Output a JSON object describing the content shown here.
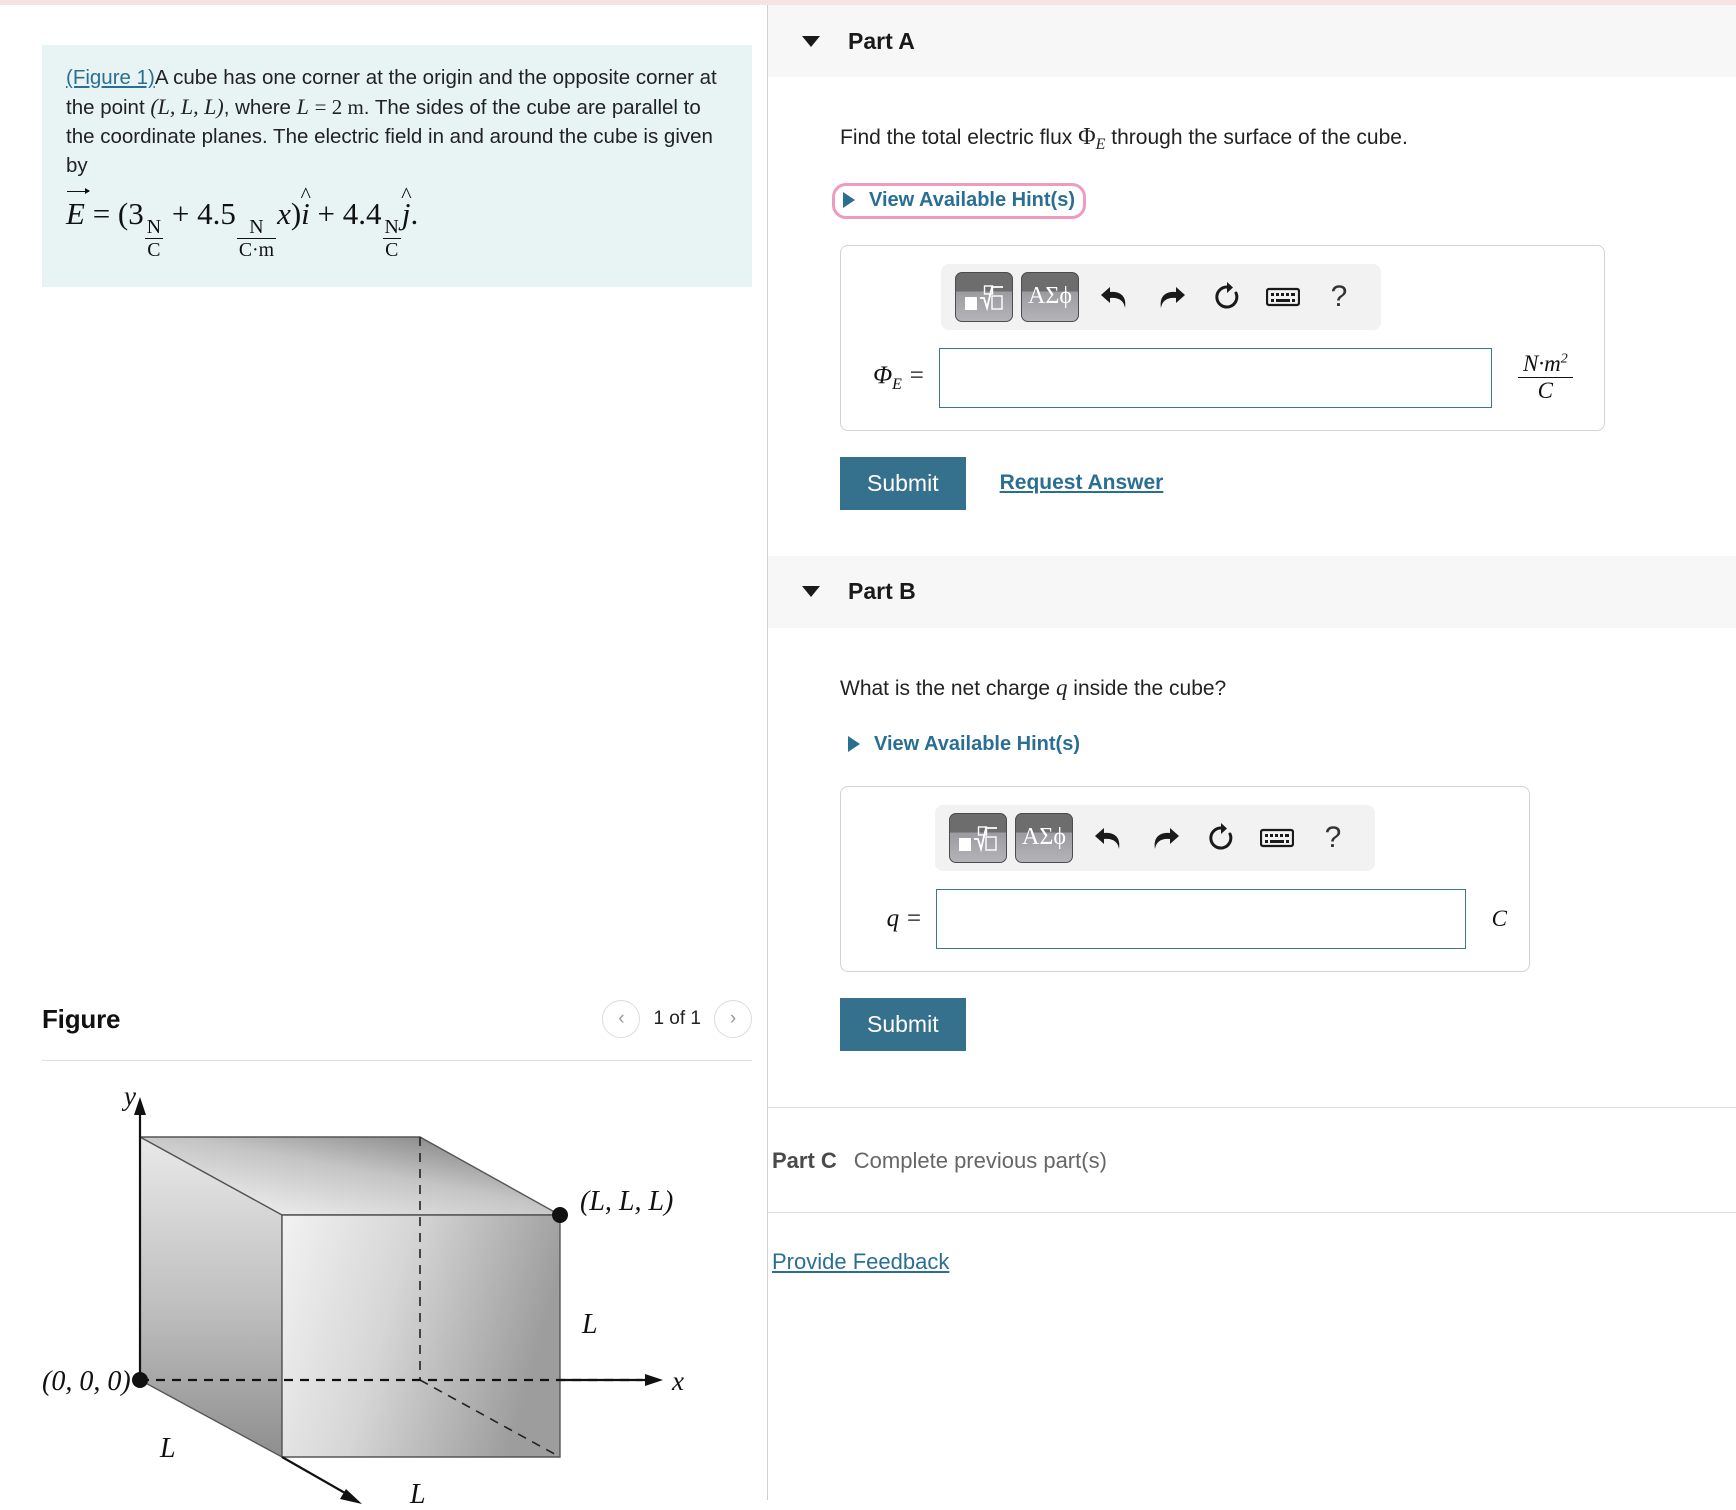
{
  "problem": {
    "figure_link": "(Figure 1)",
    "line1_rest": "A cube has one corner at the origin and the opposite",
    "line2_a": "corner at the point",
    "line2_point": "(L, L, L)",
    "line2_b": ", where",
    "line2_L": "L",
    "line2_eq": "= 2 m",
    "line2_c": ". The sides of",
    "line3": "the cube are parallel to the coordinate planes. The electric field",
    "line4": "in and around the cube is given by",
    "equation_plain": "E = (3 N/C + 4.5 N/(C·m) x) i-hat + 4.4 N/C j-hat.",
    "eq_tokens": {
      "E": "E",
      "equals": "=",
      "open": "(",
      "c1": "3",
      "u1_num": "N",
      "u1_den": "C",
      "plus1": "+",
      "c2": "4.5",
      "u2_num": "N",
      "u2_den": "C·m",
      "xvar": "x",
      "close": ")",
      "ihat": "i",
      "plus2": "+",
      "c3": "4.4",
      "u3_num": "N",
      "u3_den": "C",
      "jhat": "j",
      "period": "."
    }
  },
  "figure": {
    "title": "Figure",
    "pager": {
      "prev_icon": "chevron-left-icon",
      "next_icon": "chevron-right-icon",
      "count_label": "1 of 1"
    },
    "diagram": {
      "axis_y": "y",
      "axis_x": "x",
      "origin_label": "(0, 0, 0)",
      "far_corner_label": "(L, L, L)",
      "edge_label_right": "L",
      "edge_label_bottom": "L",
      "edge_label_depth": "L"
    }
  },
  "parts": [
    {
      "id": "part-a",
      "title": "Part A",
      "caret_icon": "caret-down-icon",
      "question_pre": "Find the total electric flux ",
      "question_symbol": "Φ",
      "question_sub": "E",
      "question_post": " through the surface of the cube.",
      "hint_label": "View Available Hint(s)",
      "hint_highlighted": true,
      "variable_label": "Φ",
      "variable_sub": "E",
      "variable_eq": "=",
      "input_value": "",
      "unit_num": "N·m",
      "unit_num_sup": "2",
      "unit_den": "C",
      "submit_label": "Submit",
      "request_label": "Request Answer"
    },
    {
      "id": "part-b",
      "title": "Part B",
      "caret_icon": "caret-down-icon",
      "question_pre": "What is the net charge ",
      "question_symbol": "q",
      "question_sub": "",
      "question_post": " inside the cube?",
      "hint_label": "View Available Hint(s)",
      "hint_highlighted": false,
      "variable_label": "q",
      "variable_sub": "",
      "variable_eq": "=",
      "input_value": "",
      "unit_simple": "C",
      "submit_label": "Submit"
    }
  ],
  "toolbar": {
    "template_btn": "math-template-icon",
    "greek_btn": "ΑΣϕ",
    "undo_icon": "undo-arrow-icon",
    "redo_icon": "redo-arrow-icon",
    "reset_icon": "reset-circular-arrow-icon",
    "keyboard_icon": "keyboard-icon",
    "help_icon": "?"
  },
  "part_c": {
    "label": "Part C",
    "status": "Complete previous part(s)"
  },
  "footer": {
    "feedback_label": "Provide Feedback"
  },
  "colors": {
    "accent_link": "#2a6f93",
    "submit_bg": "#35718c",
    "problem_bg": "#e8f4f4",
    "highlight_pink": "#ef9bbd",
    "input_border": "#3d7690"
  }
}
